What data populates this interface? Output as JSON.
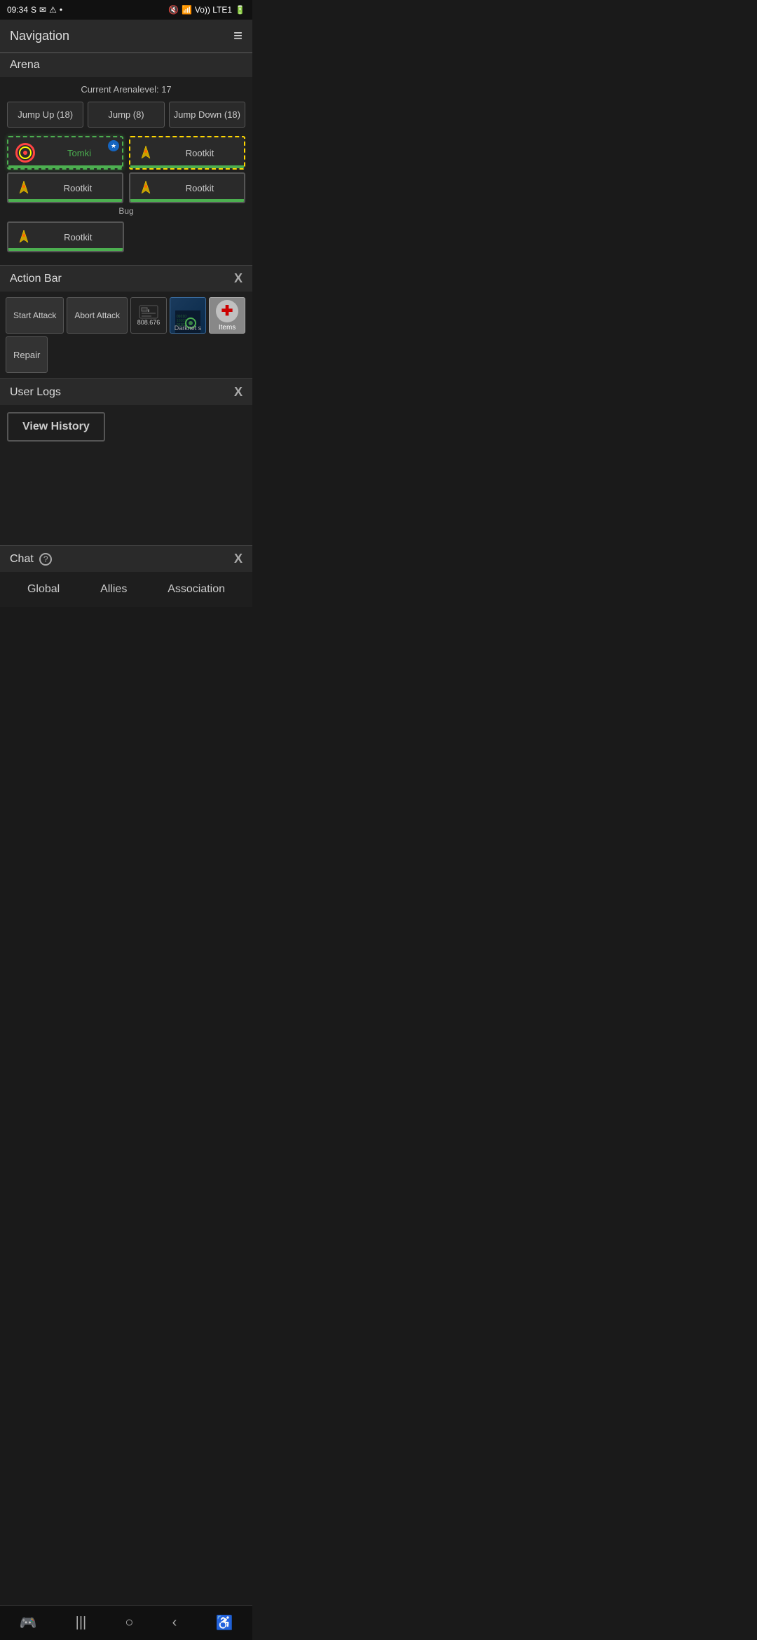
{
  "statusBar": {
    "time": "09:34",
    "icons": [
      "skype",
      "email",
      "warning",
      "dot"
    ],
    "rightIcons": [
      "mute",
      "wifi",
      "signal",
      "battery"
    ]
  },
  "navigation": {
    "title": "Navigation",
    "menuIcon": "≡"
  },
  "arena": {
    "sectionTitle": "Arena",
    "arenaLevelLabel": "Current Arenalevel: 17",
    "buttons": {
      "jumpUp": "Jump Up (18)",
      "jump": "Jump (8)",
      "jumpDown": "Jump Down (18)"
    },
    "players": [
      {
        "name": "Tomki",
        "type": "active",
        "hasTarget": true,
        "hasStar": true
      },
      {
        "name": "Rootkit",
        "type": "enemy-yellow",
        "hasStar": false
      },
      {
        "name": "Rootkit",
        "type": "normal",
        "hasStar": false
      },
      {
        "name": "Rootkit",
        "type": "normal",
        "hasStar": false
      }
    ],
    "bugLabel": "Bug",
    "bottomPlayer": {
      "name": "Rootkit",
      "type": "normal"
    }
  },
  "actionBar": {
    "sectionTitle": "Action Bar",
    "closeLabel": "X",
    "buttons": {
      "startAttack": "Start Attack",
      "abortAttack": "Abort Attack",
      "moneyAmount": "808.676",
      "darknet": "Darknet s",
      "items": "Items",
      "repair": "Repair"
    }
  },
  "userLogs": {
    "sectionTitle": "User Logs",
    "closeLabel": "X",
    "viewHistoryBtn": "View History"
  },
  "chat": {
    "sectionTitle": "Chat",
    "closeLabel": "X",
    "tabs": [
      "Global",
      "Allies",
      "Association"
    ]
  },
  "bottomNav": {
    "items": [
      "🎮",
      "|||",
      "○",
      "<",
      "♿"
    ]
  }
}
